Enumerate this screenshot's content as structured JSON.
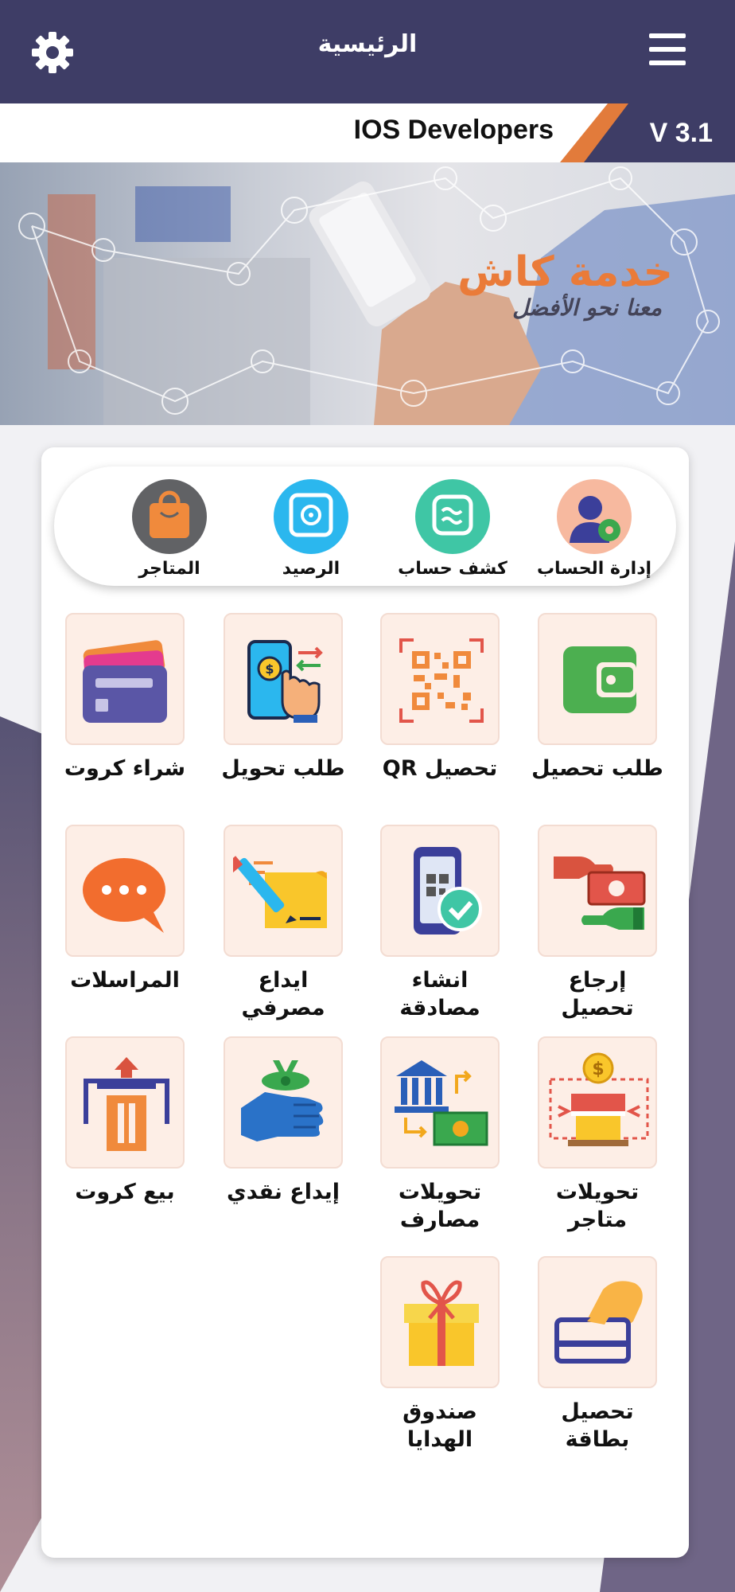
{
  "header": {
    "title": "الرئيسية",
    "settings_icon": "gear-icon",
    "menu_icon": "hamburger-menu-icon",
    "background_color": "#3e3d66"
  },
  "subbar": {
    "company": "IOS Developers",
    "version": "V 3.1",
    "accent_color": "#e27b3b"
  },
  "banner": {
    "title": "خدمة كاش",
    "subtitle": "معنا نحو الأفضل"
  },
  "quick_actions": [
    {
      "label": "إدارة الحساب",
      "icon": "account-settings-icon"
    },
    {
      "label": "كشف حساب",
      "icon": "statement-icon"
    },
    {
      "label": "الرصيد",
      "icon": "safe-icon"
    },
    {
      "label": "المتاجر",
      "icon": "shopping-bag-icon"
    }
  ],
  "services": [
    {
      "label": "طلب تحصيل",
      "icon": "wallet-icon"
    },
    {
      "label": "تحصيل QR",
      "icon": "qr-code-icon"
    },
    {
      "label": "طلب تحويل",
      "icon": "phone-transfer-icon"
    },
    {
      "label": "شراء كروت",
      "icon": "cards-icon"
    },
    {
      "label": "إرجاع\nتحصيل",
      "icon": "refund-cash-icon"
    },
    {
      "label": "انشاء\nمصادقة",
      "icon": "phone-verify-icon"
    },
    {
      "label": "ايداع\nمصرفي",
      "icon": "bank-deposit-pen-icon"
    },
    {
      "label": "المراسلات",
      "icon": "chat-bubble-icon"
    },
    {
      "label": "تحويلات\nمتاجر",
      "icon": "store-transfer-icon"
    },
    {
      "label": "تحويلات\nمصارف",
      "icon": "bank-transfer-icon"
    },
    {
      "label": "إيداع نقدي",
      "icon": "cash-deposit-icon"
    },
    {
      "label": "بيع كروت",
      "icon": "sell-cards-icon"
    },
    {
      "label": "تحصيل\nبطاقة",
      "icon": "card-payment-icon"
    },
    {
      "label": "صندوق\nالهدايا",
      "icon": "gift-box-icon"
    }
  ]
}
